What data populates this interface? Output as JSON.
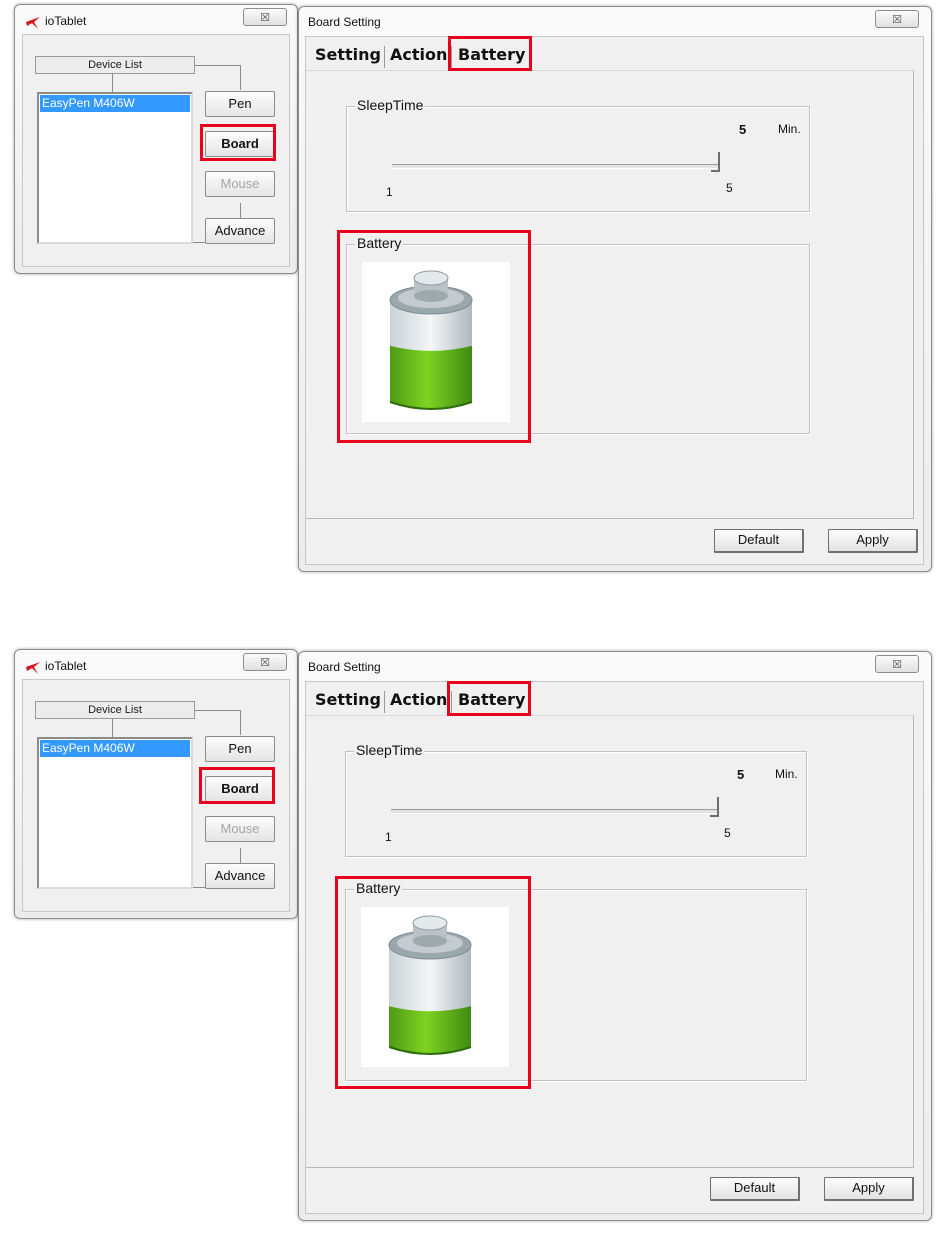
{
  "screens": [
    {
      "io_window": {
        "title": "ioTablet",
        "close_glyph": "☒",
        "device_list_header": "Device List",
        "devices": [
          "EasyPen M406W"
        ],
        "buttons": {
          "pen": "Pen",
          "board": "Board",
          "mouse": "Mouse",
          "advance": "Advance"
        }
      },
      "board_window": {
        "title": "Board Setting",
        "close_glyph": "☒",
        "tabs": {
          "setting": "Setting",
          "action": "Action",
          "battery": "Battery"
        },
        "sleep_time": {
          "label": "SleepTime",
          "value": "5",
          "unit": "Min.",
          "min_label": "1",
          "max_label": "5"
        },
        "battery_group_label": "Battery",
        "battery_level": 0.55,
        "buttons": {
          "default": "Default",
          "apply": "Apply"
        }
      }
    },
    {
      "io_window": {
        "title": "ioTablet",
        "close_glyph": "☒",
        "device_list_header": "Device List",
        "devices": [
          "EasyPen M406W"
        ],
        "buttons": {
          "pen": "Pen",
          "board": "Board",
          "mouse": "Mouse",
          "advance": "Advance"
        }
      },
      "board_window": {
        "title": "Board Setting",
        "close_glyph": "☒",
        "tabs": {
          "setting": "Setting",
          "action": "Action",
          "battery": "Battery"
        },
        "sleep_time": {
          "label": "SleepTime",
          "value": "5",
          "unit": "Min.",
          "min_label": "1",
          "max_label": "5"
        },
        "battery_group_label": "Battery",
        "battery_level": 0.4,
        "buttons": {
          "default": "Default",
          "apply": "Apply"
        }
      }
    }
  ],
  "colors": {
    "highlight": "#e8001c",
    "selection": "#3399ff",
    "battery_green": "#7ed321",
    "battery_cap": "#9aa7ad"
  },
  "icons": {
    "logo": "iotablet-logo-icon",
    "close": "close-icon",
    "battery": "battery-icon"
  }
}
